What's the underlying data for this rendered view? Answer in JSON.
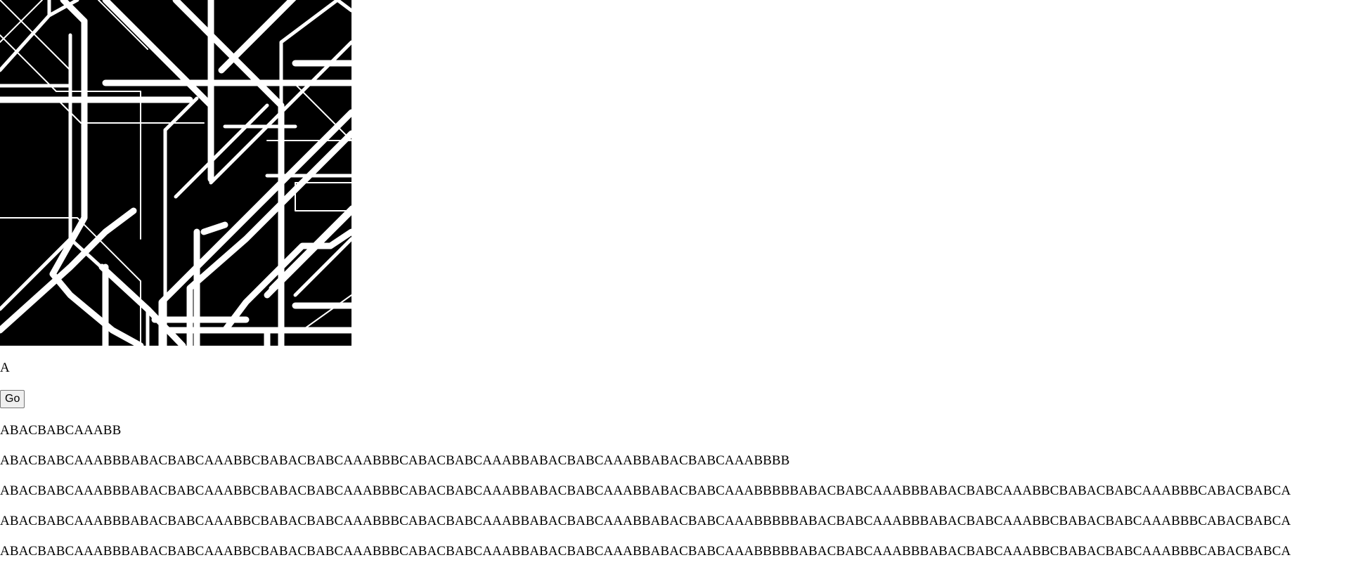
{
  "canvas": {
    "background": "#000000",
    "stroke": "#ffffff"
  },
  "axiom": "A",
  "go_button": "Go",
  "generations": [
    "ABACBABCAAABB",
    "ABACBABCAAABBBABACBABCAAABBCBABACBABCAAABBBCABACBABCAAABBABACBABCAAABBABACBABCAAABBBB",
    "ABACBABCAAABBBABACBABCAAABBCBABACBABCAAABBBCABACBABCAAABBABACBABCAAABBABACBABCAAABBBBBABACBABCAAABBBABACBABCAAABBCBABACBABCAAABBBCABACBABCA",
    "ABACBABCAAABBBABACBABCAAABBCBABACBABCAAABBBCABACBABCAAABBABACBABCAAABBABACBABCAAABBBBBABACBABCAAABBBABACBABCAAABBCBABACBABCAAABBBCABACBABCA",
    "ABACBABCAAABBBABACBABCAAABBCBABACBABCAAABBBCABACBABCAAABBABACBABCAAABBABACBABCAAABBBBBABACBABCAAABBBABACBABCAAABBCBABACBABCAAABBBCABACBABCA"
  ]
}
